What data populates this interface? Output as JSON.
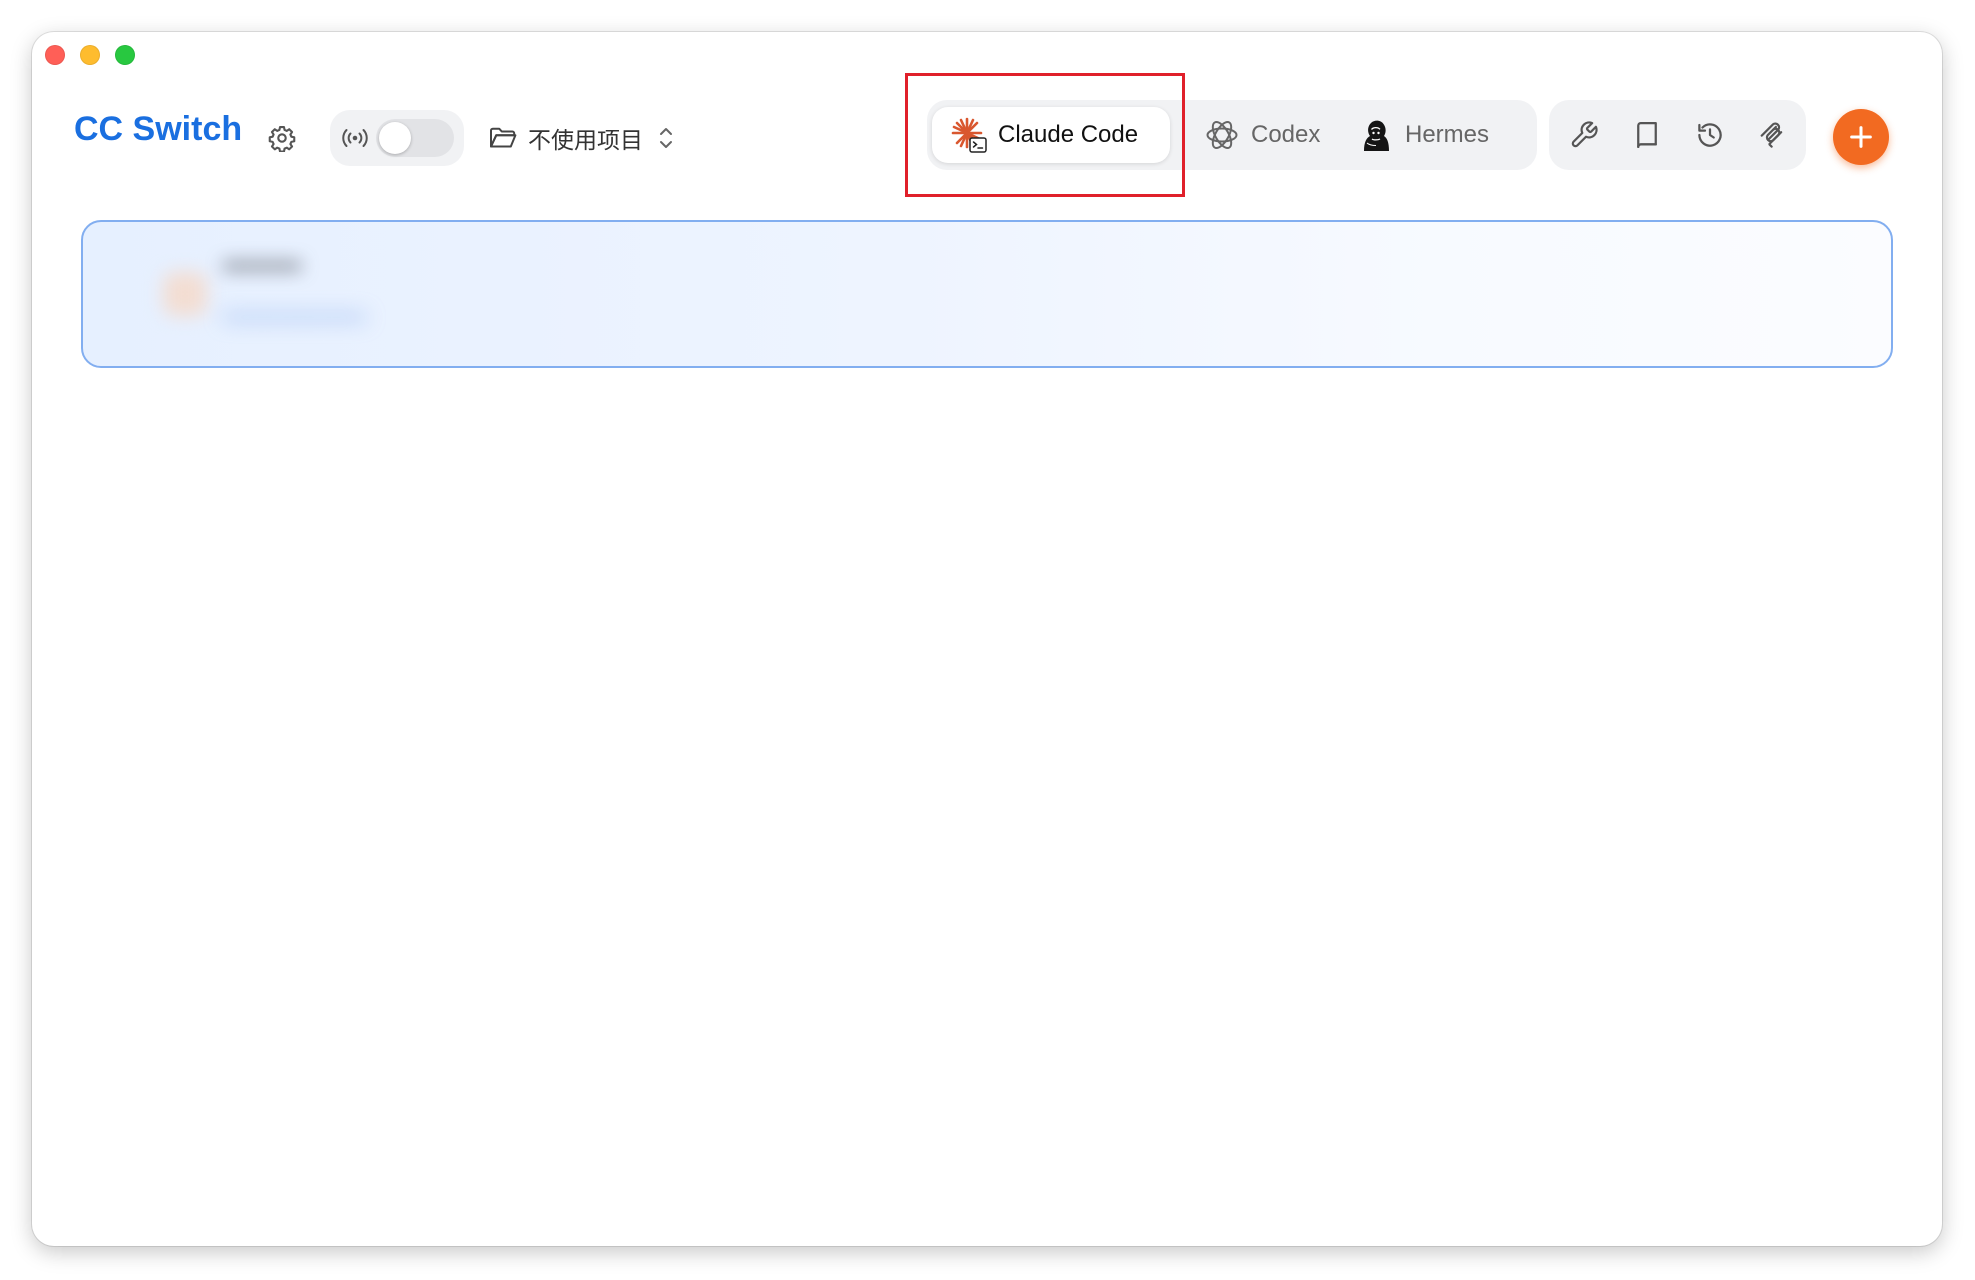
{
  "window": {
    "controls": [
      "close",
      "minimize",
      "maximize"
    ]
  },
  "header": {
    "title": "CC Switch",
    "settings_icon": "gear-icon",
    "proxy": {
      "icon": "broadcast-icon",
      "enabled": false
    },
    "project_selector": {
      "icon": "folder-icon",
      "label": "不使用项目",
      "chevron_icon": "chevron-up-down-icon"
    },
    "app_tabs": [
      {
        "label": "Claude Code",
        "icon": "claude-code-icon",
        "active": true
      },
      {
        "label": "Codex",
        "icon": "openai-icon",
        "active": false
      },
      {
        "label": "Hermes",
        "icon": "hermes-icon",
        "active": false
      }
    ],
    "tools": [
      {
        "icon": "wrench-icon"
      },
      {
        "icon": "book-icon"
      },
      {
        "icon": "history-icon"
      },
      {
        "icon": "mcp-icon"
      }
    ],
    "add_icon": "plus-icon"
  },
  "provider_list": {
    "items": [
      {
        "name": "••••••••",
        "url": "•••••••••••••••••",
        "active": true,
        "obscured": true
      }
    ]
  },
  "colors": {
    "title_blue": "#1a6fe0",
    "add_orange": "#f26a21",
    "highlight_red": "#e0202a",
    "card_border": "#82aef0",
    "claude_orange": "#d9572f"
  }
}
